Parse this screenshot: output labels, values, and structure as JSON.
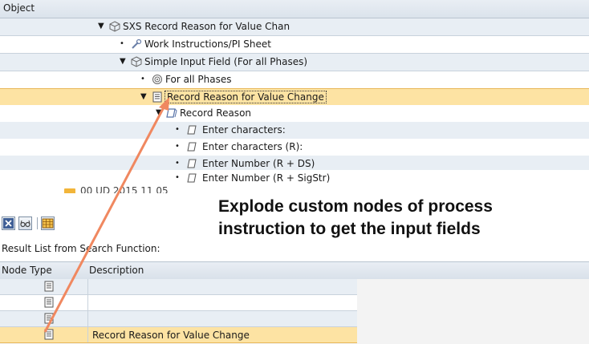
{
  "tree": {
    "header": "Object",
    "nodes": [
      {
        "label": "SXS Record Reason for Value Chan",
        "lead": "▼",
        "icon": "process-icon"
      },
      {
        "label": "Work Instructions/PI Sheet",
        "lead": "•",
        "icon": "wrench-icon"
      },
      {
        "label": "Simple Input Field (For all Phases)",
        "lead": "▼",
        "icon": "process-icon"
      },
      {
        "label": "For all Phases",
        "lead": "•",
        "icon": "target-icon"
      },
      {
        "label": "Record Reason for Value Change",
        "lead": "▼",
        "icon": "document-icon"
      },
      {
        "label": "Record Reason",
        "lead": "▼",
        "icon": "parameter-icon"
      },
      {
        "label": "Enter characters:",
        "lead": "•",
        "icon": "field-icon"
      },
      {
        "label": "Enter characters (R):",
        "lead": "•",
        "icon": "field-icon"
      },
      {
        "label": "Enter Number (R + DS)",
        "lead": "•",
        "icon": "field-icon"
      },
      {
        "label": "Enter Number (R + SigStr)",
        "lead": "•",
        "icon": "field-icon"
      }
    ],
    "partial_row": "00 UD 2015 11 05"
  },
  "toolbar": {
    "buttons": [
      "close-icon",
      "glasses-icon",
      "grid-icon"
    ]
  },
  "results": {
    "label": "Result List from Search Function:",
    "columns": [
      "Node Type",
      "Description"
    ],
    "rows": [
      {
        "description": ""
      },
      {
        "description": ""
      },
      {
        "description": ""
      },
      {
        "description": "Record Reason for Value Change"
      }
    ]
  },
  "annotation": {
    "line1": "Explode custom nodes of process",
    "line2": "instruction to get the input fields"
  },
  "colors": {
    "selection": "#fde3a3",
    "row_bg": "#e8eef4",
    "arrow": "#f08860"
  }
}
